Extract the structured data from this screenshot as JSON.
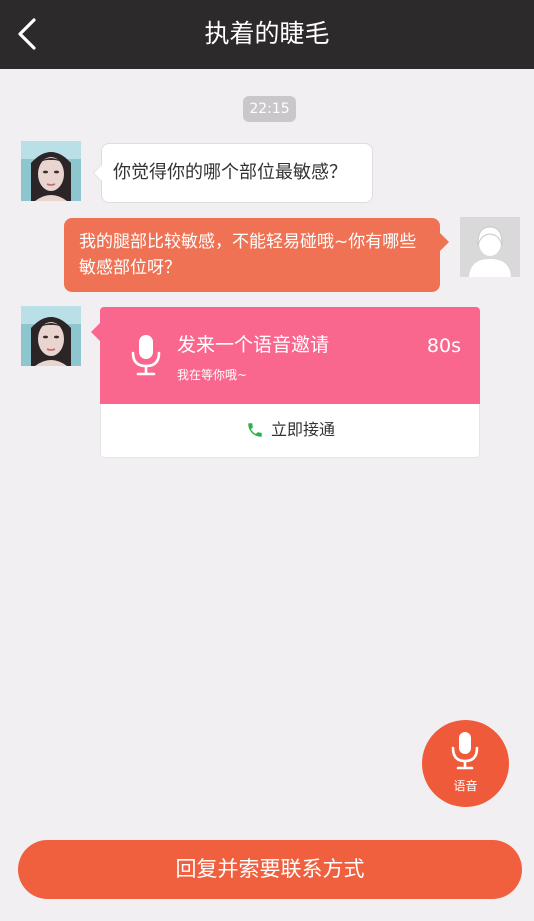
{
  "header": {
    "title": "执着的睫毛",
    "back_icon": "chevron-left-icon"
  },
  "conversation": {
    "timestamp": "22:15",
    "messages": [
      {
        "sender": "other",
        "text": "你觉得你的哪个部位最敏感？"
      },
      {
        "sender": "me",
        "text": "我的腿部比较敏感，不能轻易碰哦~你有哪些敏感部位呀？"
      }
    ],
    "voice_invite": {
      "title": "发来一个语音邀请",
      "subtitle": "我在等你哦~",
      "duration": "80s",
      "connect_label": "立即接通",
      "icon": "microphone-icon",
      "accent_color": "#f9678e"
    }
  },
  "voice_button": {
    "label": "语音",
    "icon": "microphone-icon",
    "color": "#ef5a3b"
  },
  "footer": {
    "reply_label": "回复并索要联系方式",
    "color": "#f0603f"
  }
}
